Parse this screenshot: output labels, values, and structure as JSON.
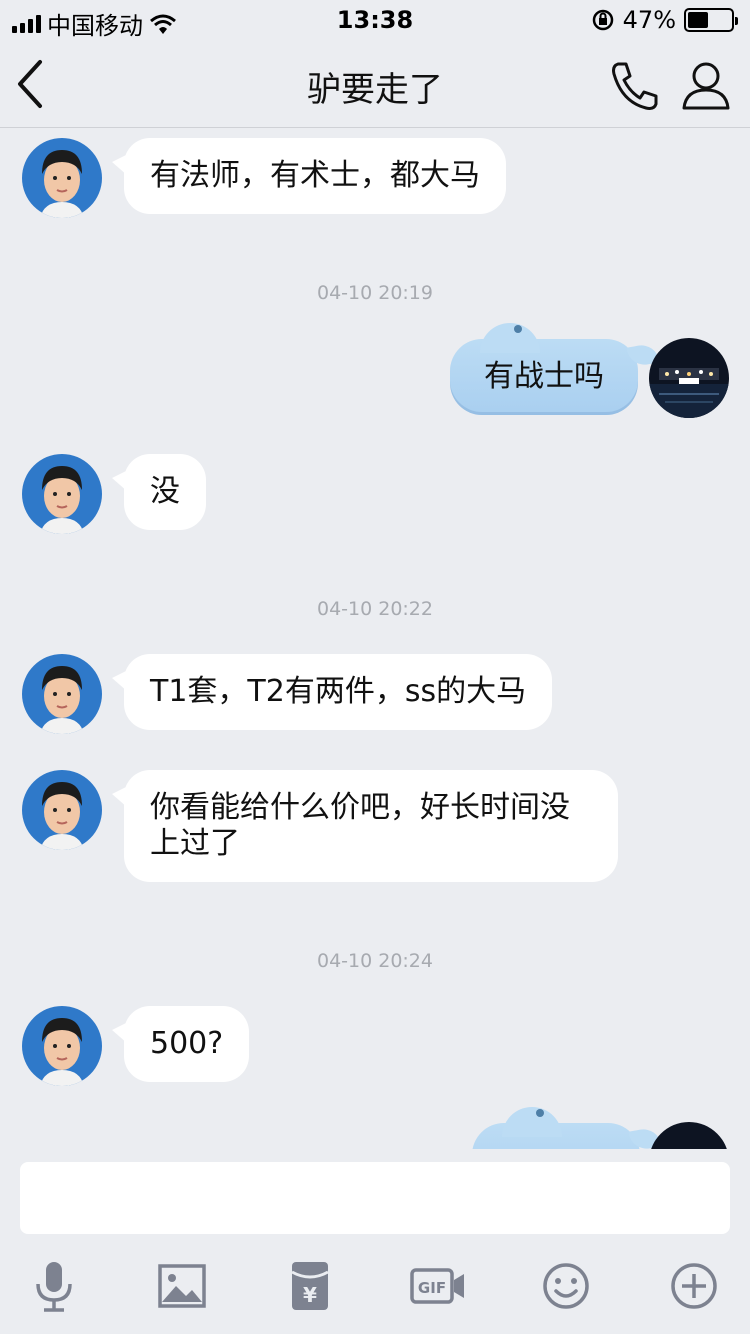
{
  "status_bar": {
    "carrier": "中国移动",
    "time": "13:38",
    "battery_percent": "47%",
    "battery_level": 0.47
  },
  "nav": {
    "title": "驴要走了"
  },
  "messages": [
    {
      "type": "left",
      "text": "有法师，有术士，都大马"
    },
    {
      "type": "time",
      "text": "04-10 20:19"
    },
    {
      "type": "right",
      "text": "有战士吗"
    },
    {
      "type": "left",
      "text": "没"
    },
    {
      "type": "time",
      "text": "04-10 20:22"
    },
    {
      "type": "left",
      "text": "T1套，T2有两件，ss的大马"
    },
    {
      "type": "left",
      "text": "你看能给什么价吧，好长时间没上过了"
    },
    {
      "type": "time",
      "text": "04-10 20:24"
    },
    {
      "type": "left",
      "text": "500?"
    },
    {
      "type": "right",
      "text": ""
    }
  ],
  "input": {
    "value": ""
  },
  "toolbar": {
    "icons": [
      "microphone-icon",
      "image-icon",
      "red-packet-icon",
      "gif-icon",
      "emoji-icon",
      "plus-icon"
    ]
  },
  "colors": {
    "background": "#ebedf1",
    "left_bubble": "#ffffff",
    "right_bubble": "#bcdcf4",
    "timestamp": "#a7aab0",
    "icon": "#7d8290",
    "avatar_bg": "#2f79c9"
  }
}
